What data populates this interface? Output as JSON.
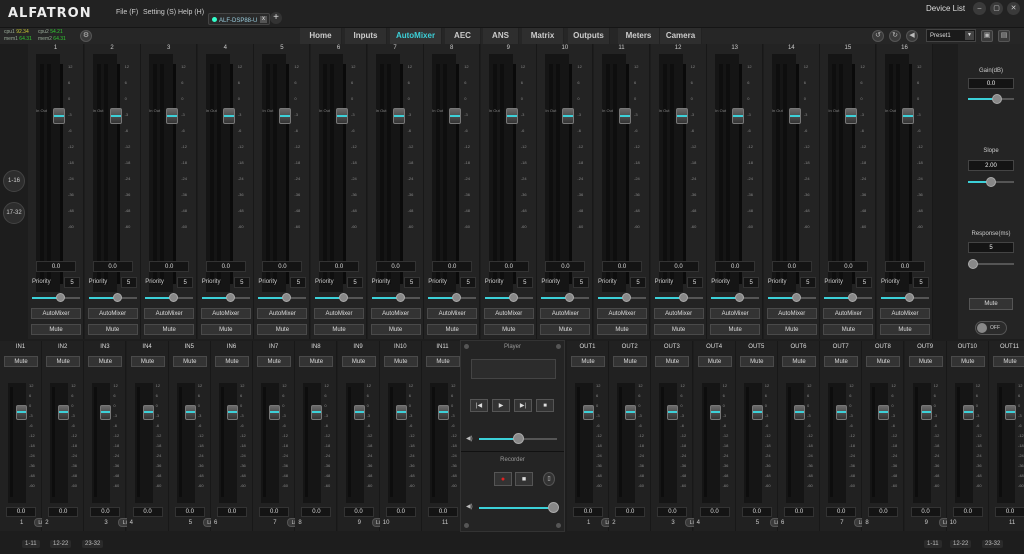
{
  "app": {
    "logo": "ALFATRON",
    "device_list": "Device List"
  },
  "menu": [
    {
      "label": "File (F)"
    },
    {
      "label": "Setting (S)"
    },
    {
      "label": "Help (H)"
    }
  ],
  "device_tab": {
    "label": "ALF-DSP88-U",
    "close": "x",
    "add": "+"
  },
  "window": {
    "min": "–",
    "max": "▢",
    "close": "✕"
  },
  "status": {
    "cpu1_label": "cpu1",
    "cpu1_val": "92.34",
    "mem1_label": "mem1",
    "mem1_val": "64.31",
    "cpu2_label": "cpu2",
    "cpu2_val": "54.21",
    "mem2_label": "mem2",
    "mem2_val": "64.31"
  },
  "nav": {
    "tabs": [
      {
        "label": "Home"
      },
      {
        "label": "Inputs"
      },
      {
        "label": "AutoMixer"
      },
      {
        "label": "AEC"
      },
      {
        "label": "ANS"
      },
      {
        "label": "Matrix"
      },
      {
        "label": "Outputs"
      },
      {
        "label": "Meters"
      },
      {
        "label": "Camera"
      }
    ],
    "active": "AutoMixer",
    "preset": "Preset1"
  },
  "side": {
    "page1": "1-16",
    "page2": "17-32"
  },
  "automixer": {
    "channels": [
      "1",
      "2",
      "3",
      "4",
      "5",
      "6",
      "7",
      "8",
      "9",
      "10",
      "11",
      "12",
      "13",
      "14",
      "15",
      "16"
    ],
    "value": "0.0",
    "priority_label": "Priority",
    "priority_value": "5",
    "automixer_button": "AutoMixer",
    "mute_button": "Mute",
    "in_label": "In",
    "out_label": "Out",
    "scale": [
      "12",
      "6",
      "0",
      "-3",
      "-6",
      "-12",
      "-18",
      "-24",
      "-36",
      "-48",
      "-60"
    ],
    "fader_level_db": 0
  },
  "panel": {
    "gain_label": "Gain(dB)",
    "gain_value": "0.0",
    "slope_label": "Slope",
    "slope_value": "2.00",
    "response_label": "Response(ms)",
    "response_value": "5",
    "mute": "Mute",
    "toggle": "OFF"
  },
  "inputs": [
    {
      "label": "IN1"
    },
    {
      "label": "IN2"
    },
    {
      "label": "IN3"
    },
    {
      "label": "IN4"
    },
    {
      "label": "IN5"
    },
    {
      "label": "IN6"
    },
    {
      "label": "IN7"
    },
    {
      "label": "IN8"
    },
    {
      "label": "IN9"
    },
    {
      "label": "IN10"
    },
    {
      "label": "IN11"
    }
  ],
  "outputs": [
    {
      "label": "OUT1"
    },
    {
      "label": "OUT2"
    },
    {
      "label": "OUT3"
    },
    {
      "label": "OUT4"
    },
    {
      "label": "OUT5"
    },
    {
      "label": "OUT6"
    },
    {
      "label": "OUT7"
    },
    {
      "label": "OUT8"
    },
    {
      "label": "OUT9"
    },
    {
      "label": "OUT10"
    },
    {
      "label": "OUT11"
    }
  ],
  "io": {
    "mute": "Mute",
    "value": "0.0",
    "link": "Link",
    "scale": [
      "12",
      "6",
      "0",
      "-3",
      "-6",
      "-12",
      "-18",
      "-24",
      "-36",
      "-48",
      "-60"
    ]
  },
  "input_nums": [
    "1",
    "2",
    "3",
    "4",
    "5",
    "6",
    "7",
    "8",
    "9",
    "10",
    "11"
  ],
  "output_nums": [
    "1",
    "2",
    "3",
    "4",
    "5",
    "6",
    "7",
    "8",
    "9",
    "10",
    "11"
  ],
  "bottom": {
    "in_pages": [
      "1-11",
      "12-22",
      "23-32"
    ],
    "out_pages": [
      "1-11",
      "12-22",
      "23-32"
    ]
  },
  "player": {
    "title": "Player",
    "recorder": "Recorder",
    "prev": "|◀",
    "play": "▶",
    "next": "▶|",
    "stop": "■",
    "player_volume": 0.5,
    "recorder_volume": 0.95
  },
  "colors": {
    "accent": "#3cd0d8",
    "record": "#e02020"
  }
}
